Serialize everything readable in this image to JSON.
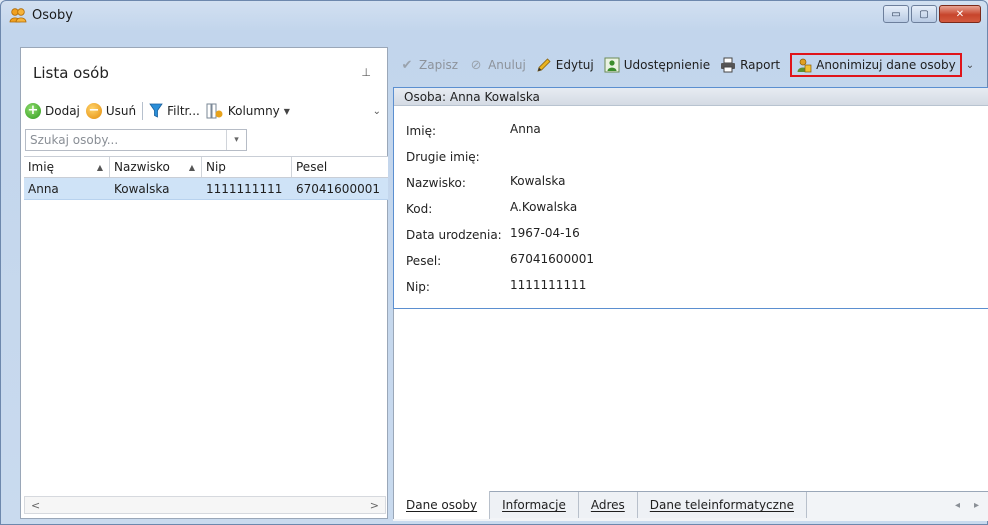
{
  "window": {
    "title": "Osoby",
    "buttons": {
      "minimize": "▭",
      "maximize": "▢",
      "close": "✕"
    }
  },
  "left_panel": {
    "title": "Lista osób",
    "pin": "⊥",
    "toolbar": {
      "add": "Dodaj",
      "remove": "Usuń",
      "filter": "Filtr...",
      "columns": "Kolumny",
      "more": "⌄"
    },
    "search_placeholder": "Szukaj osoby...",
    "columns": [
      "Imię",
      "Nazwisko",
      "Nip",
      "Pesel"
    ],
    "rows": [
      [
        "Anna",
        "Kowalska",
        "1111111111",
        "67041600001"
      ]
    ],
    "scroll": {
      "left": "<",
      "right": ">"
    }
  },
  "toolbar": {
    "save": "Zapisz",
    "cancel": "Anuluj",
    "edit": "Edytuj",
    "share": "Udostępnienie",
    "report": "Raport",
    "anonymize": "Anonimizuj dane osoby",
    "more": "⌄"
  },
  "detail": {
    "header": "Osoba: Anna  Kowalska",
    "fields": [
      {
        "label": "Imię:",
        "value": "Anna"
      },
      {
        "label": "Drugie imię:",
        "value": ""
      },
      {
        "label": "Nazwisko:",
        "value": "Kowalska"
      },
      {
        "label": "Kod:",
        "value": "A.Kowalska"
      },
      {
        "label": "Data urodzenia:",
        "value": "1967-04-16"
      },
      {
        "label": "Pesel:",
        "value": "67041600001"
      },
      {
        "label": "Nip:",
        "value": "1111111111"
      }
    ]
  },
  "tabs": [
    "Dane osoby",
    "Informacje",
    "Adres",
    "Dane teleinformatyczne"
  ],
  "tab_nav": {
    "prev": "◂",
    "next": "▸"
  },
  "colors": {
    "highlight": "#e0141a",
    "selection": "#cfe3f7"
  }
}
